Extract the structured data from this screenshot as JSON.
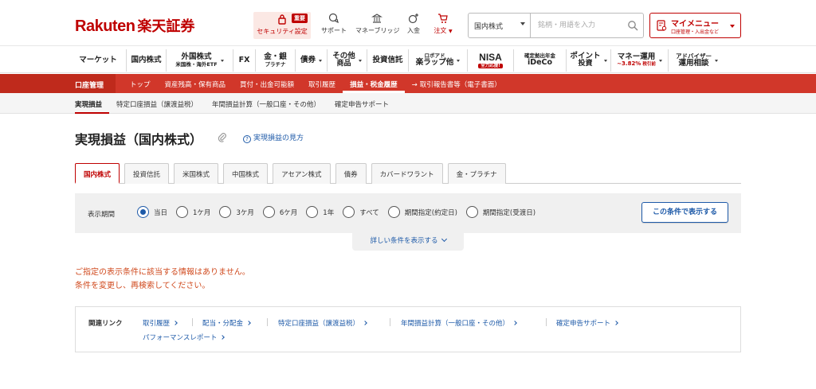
{
  "header": {
    "logo_text": "Rakuten",
    "logo_jp": "楽天証券",
    "security": {
      "badge": "重要",
      "label": "セキュリティ設定"
    },
    "support_label": "サポート",
    "bridge_label": "マネーブリッジ",
    "deposit_label": "入金",
    "order_label": "注文",
    "search": {
      "category": "国内株式",
      "placeholder": "銘柄・用語を入力"
    },
    "mymenu": {
      "title": "マイメニュー",
      "subtitle": "口座管理・入出金など"
    }
  },
  "gnav": {
    "market": "マーケット",
    "domestic": "国内株式",
    "foreign_top": "外国株式",
    "foreign_sub": "米国株・海外ETF",
    "fx": "FX",
    "gold_top": "金・銀",
    "gold_sub": "プラチナ",
    "bond": "債券",
    "other_top": "その他",
    "other_sub": "商品",
    "fund": "投資信託",
    "robo_top": "ロボアド",
    "robo_sub": "楽ラップ他",
    "nisa": "NISA",
    "nisa_badge": "全力応援!",
    "ideco_top": "確定拠出年金",
    "ideco_sub": "iDeCo",
    "point_top": "ポイント",
    "point_sub": "投資",
    "money_top": "マネー運用",
    "money_rate": "~3.82%",
    "money_rate_sub": "税引前",
    "advisor_top": "アドバイザー",
    "advisor_sub": "運用相談"
  },
  "rnav": {
    "head": "口座管理",
    "items": [
      "トップ",
      "資産残高・保有商品",
      "買付・出金可能額",
      "取引履歴",
      "損益・税金履歴",
      "取引報告書等（電子書面）"
    ]
  },
  "gsub": {
    "items": [
      "実現損益",
      "特定口座損益（譲渡益税）",
      "年間損益計算（一般口座・その他）",
      "確定申告サポート"
    ]
  },
  "page": {
    "title": "実現損益（国内株式）",
    "help": "実現損益の見方"
  },
  "ptabs": [
    "国内株式",
    "投資信託",
    "米国株式",
    "中国株式",
    "アセアン株式",
    "債券",
    "カバードワラント",
    "金・プラチナ"
  ],
  "filter": {
    "label": "表示期間",
    "options": [
      "当日",
      "1ケ月",
      "3ケ月",
      "6ケ月",
      "1年",
      "すべて",
      "期間指定(約定日)",
      "期間指定(受渡日)"
    ],
    "selected_index": 0,
    "button": "この条件で表示する",
    "detail_toggle": "詳しい条件を表示する"
  },
  "message": {
    "line1": "ご指定の表示条件に該当する情報はありません。",
    "line2": "条件を変更し、再検索してください。"
  },
  "related": {
    "label": "関連リンク",
    "links": [
      "取引履歴",
      "配当・分配金",
      "特定口座損益（譲渡益税）",
      "年間損益計算（一般口座・その他）",
      "確定申告サポート",
      "パフォーマンスレポート"
    ]
  },
  "colors": {
    "brand": "#bf0000",
    "link": "#1e5aa8",
    "nav_red": "#d1372a",
    "message": "#d04a1e"
  }
}
